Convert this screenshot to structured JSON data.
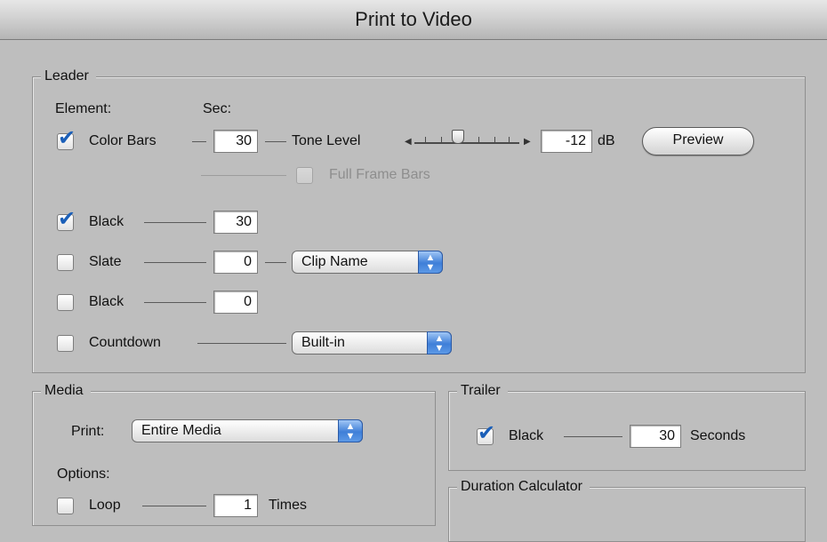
{
  "window": {
    "title": "Print to Video"
  },
  "leader": {
    "legend": "Leader",
    "element_label": "Element:",
    "sec_label": "Sec:",
    "color_bars": {
      "label": "Color Bars",
      "checked": true,
      "sec": "30"
    },
    "tone_level": {
      "label": "Tone Level",
      "value": "-12",
      "unit": "dB",
      "slider_fraction": 0.5
    },
    "preview_button": "Preview",
    "full_frame_bars": {
      "label": "Full Frame Bars",
      "checked": false,
      "enabled": false
    },
    "black1": {
      "label": "Black",
      "checked": true,
      "sec": "30"
    },
    "slate": {
      "label": "Slate",
      "checked": false,
      "sec": "0",
      "source": "Clip Name"
    },
    "black2": {
      "label": "Black",
      "checked": false,
      "sec": "0"
    },
    "countdown": {
      "label": "Countdown",
      "checked": false,
      "type": "Built-in"
    }
  },
  "media": {
    "legend": "Media",
    "print_label": "Print:",
    "print_value": "Entire Media",
    "options_label": "Options:",
    "loop": {
      "label": "Loop",
      "checked": false,
      "times": "1",
      "times_label": "Times"
    }
  },
  "trailer": {
    "legend": "Trailer",
    "black": {
      "label": "Black",
      "checked": true,
      "seconds": "30",
      "seconds_label": "Seconds"
    }
  },
  "duration_calculator": {
    "legend": "Duration Calculator"
  },
  "colors": {
    "checkmark": "#1b5fb8",
    "popup_arrow": "#3f7fd8",
    "background": "#bebebe"
  }
}
